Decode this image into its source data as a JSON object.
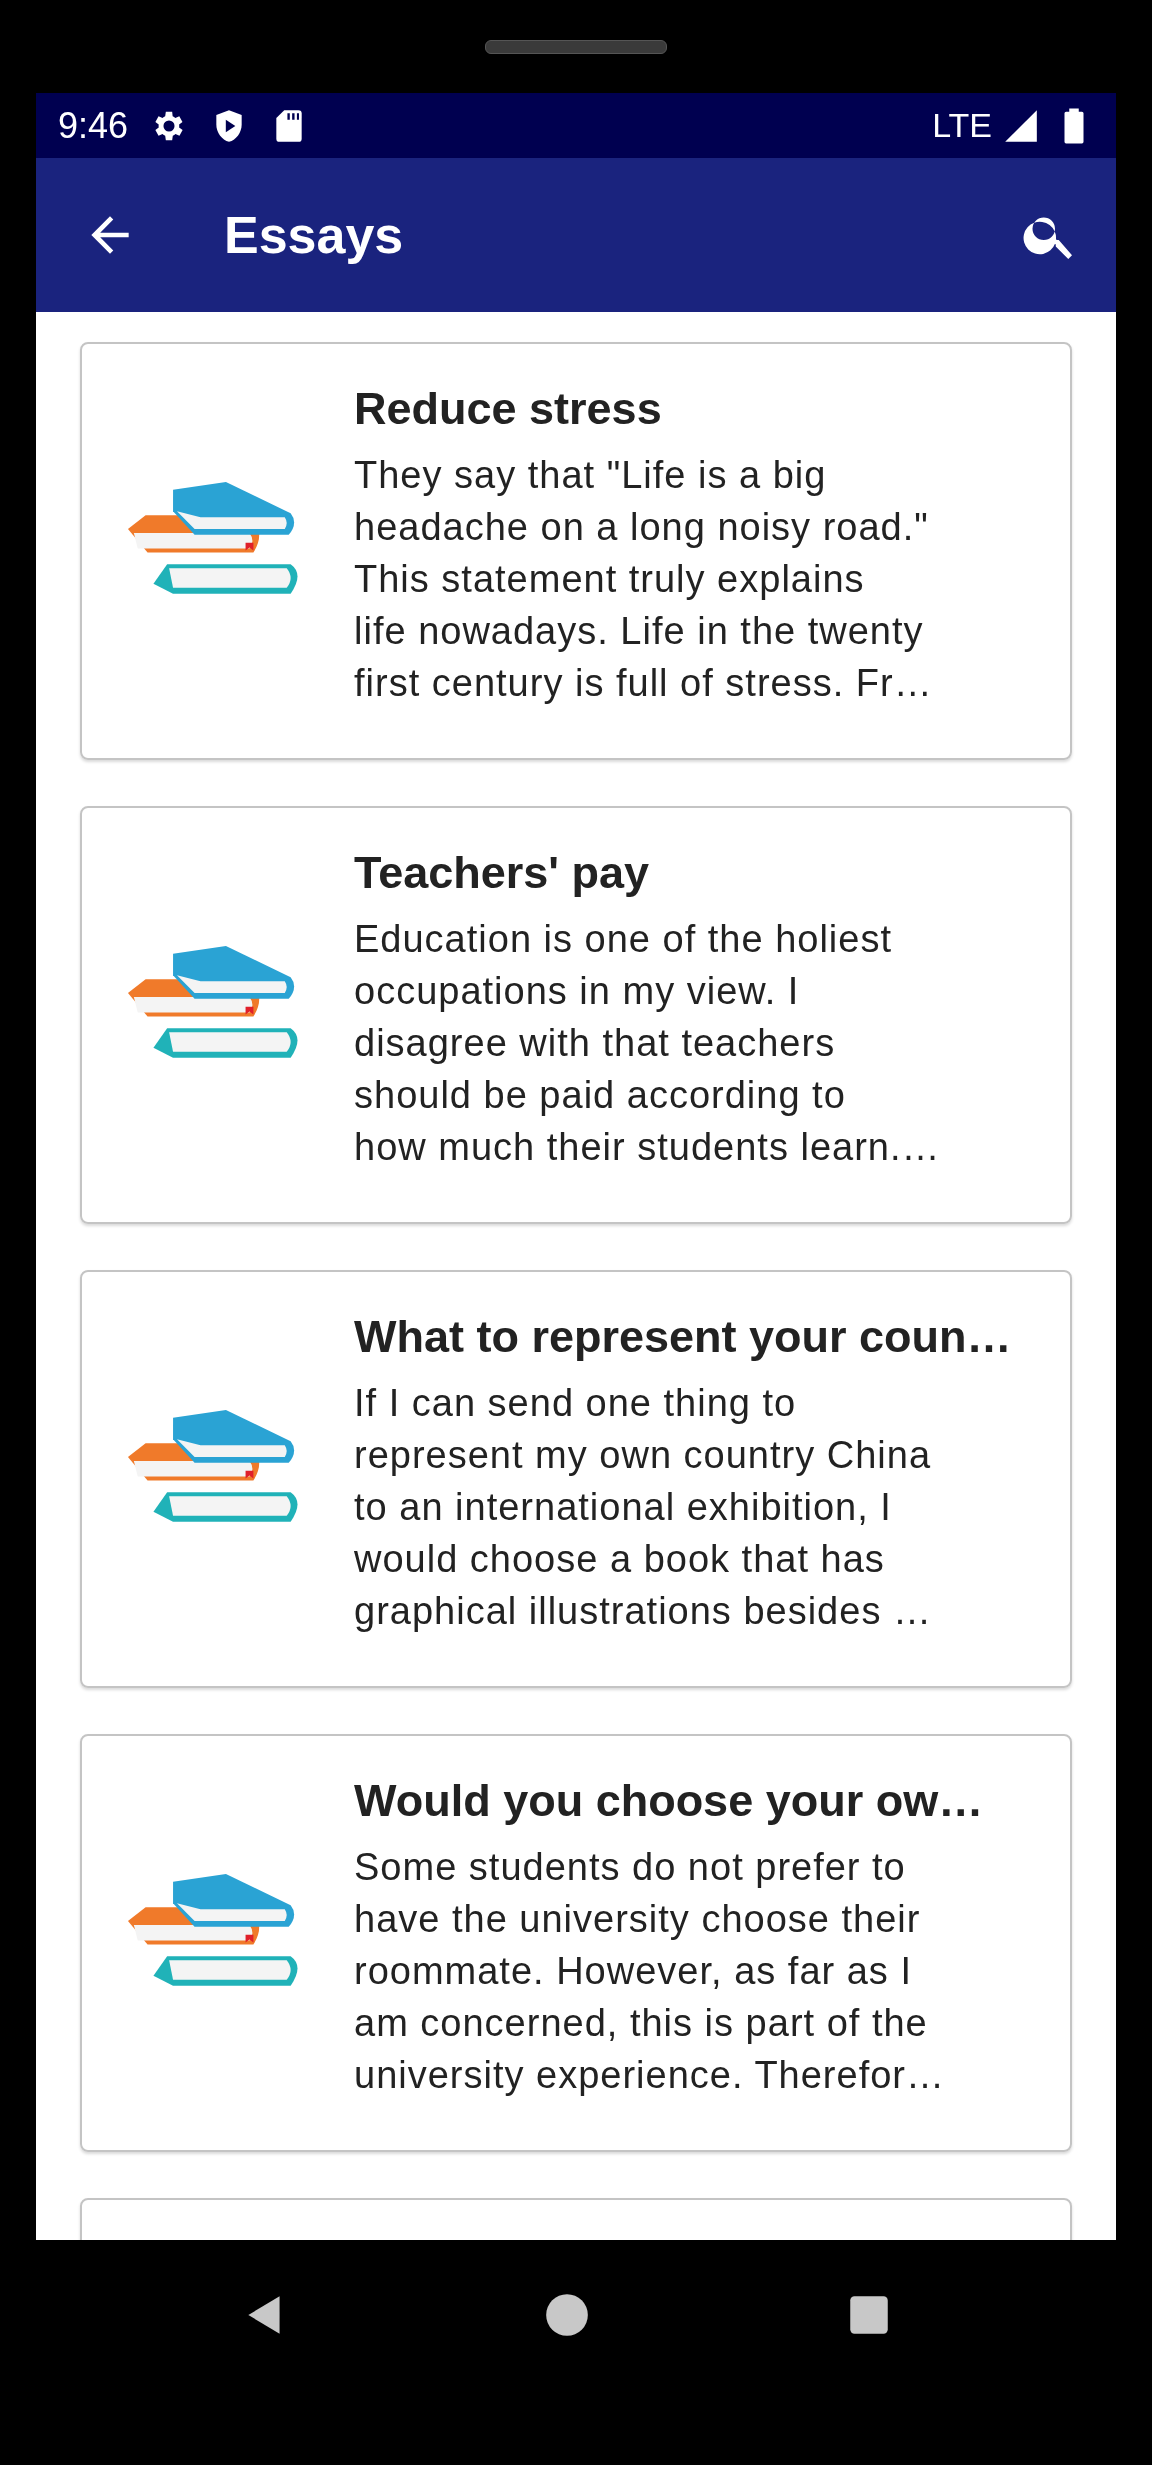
{
  "status_bar": {
    "time": "9:46",
    "network": "LTE"
  },
  "app_bar": {
    "title": "Essays"
  },
  "essays": [
    {
      "title": "Reduce stress",
      "excerpt": "They say that \"Life is a big\nheadache on a long noisy road.\"\nThis statement truly explains\nlife nowadays. Life in the twenty\nfirst century is full of stress. Fr…"
    },
    {
      "title": "Teachers' pay",
      "excerpt": "Education is one of the holiest\noccupations in my view. I\ndisagree with that teachers\nshould be paid according to\nhow much their students learn.…"
    },
    {
      "title": "What to represent your coun…",
      "excerpt": "If I can send one thing to\nrepresent my own country China\nto an international exhibition, I\nwould choose a book that has\ngraphical illustrations besides …"
    },
    {
      "title": "Would you choose  your ow…",
      "excerpt": "Some students do not prefer to\nhave the university choose their\nroommate. However, as far as I\nam concerned, this is part of the\nuniversity experience. Therefor…"
    }
  ]
}
